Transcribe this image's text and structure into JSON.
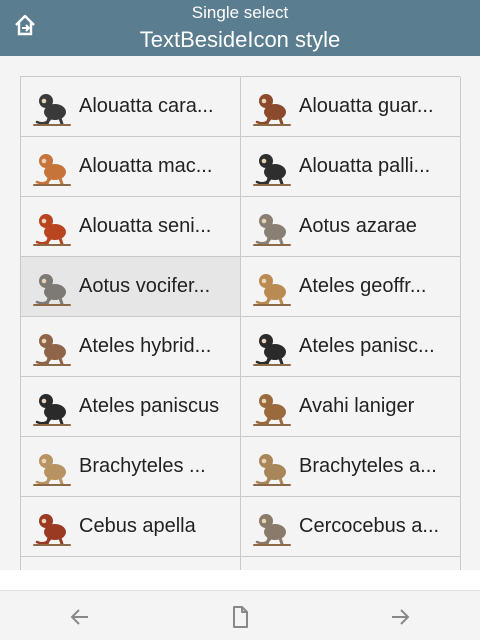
{
  "header": {
    "subtitle": "Single select",
    "title": "TextBesideIcon style"
  },
  "grid": {
    "selected_index": 6,
    "items": [
      {
        "label": "Alouatta cara...",
        "icon": "howler-monkey-black-icon",
        "color": "#3a3a3a"
      },
      {
        "label": "Alouatta guar...",
        "icon": "howler-monkey-brown-icon",
        "color": "#8b4a2b"
      },
      {
        "label": "Alouatta mac...",
        "icon": "howler-monkey-orange-icon",
        "color": "#c7743b"
      },
      {
        "label": "Alouatta palli...",
        "icon": "howler-monkey-dark-icon",
        "color": "#2e2e2e"
      },
      {
        "label": "Alouatta seni...",
        "icon": "howler-monkey-red-icon",
        "color": "#b8451f"
      },
      {
        "label": "Aotus azarae",
        "icon": "night-monkey-icon",
        "color": "#8a7f73"
      },
      {
        "label": "Aotus vocifer...",
        "icon": "night-monkey-gray-icon",
        "color": "#7d7a75"
      },
      {
        "label": "Ateles geoffr...",
        "icon": "spider-monkey-tan-icon",
        "color": "#b98a52"
      },
      {
        "label": "Ateles hybrid...",
        "icon": "spider-monkey-hanging-icon",
        "color": "#8e6548"
      },
      {
        "label": "Ateles panisc...",
        "icon": "spider-monkey-black-icon",
        "color": "#2a2a2a"
      },
      {
        "label": "Ateles paniscus",
        "icon": "spider-monkey-black-hanging-icon",
        "color": "#2a2a2a"
      },
      {
        "label": "Avahi laniger",
        "icon": "woolly-lemur-icon",
        "color": "#9a6a3e"
      },
      {
        "label": "Brachyteles ...",
        "icon": "muriqui-icon",
        "color": "#b89362"
      },
      {
        "label": "Brachyteles a...",
        "icon": "muriqui-hanging-icon",
        "color": "#a8865a"
      },
      {
        "label": "Cebus apella",
        "icon": "capuchin-icon",
        "color": "#9b3a22"
      },
      {
        "label": "Cercocebus a...",
        "icon": "mangabey-icon",
        "color": "#8a7a6a"
      },
      {
        "label": "",
        "icon": "monkey-icon",
        "color": "#888888"
      },
      {
        "label": "",
        "icon": "monkey-icon",
        "color": "#888888"
      }
    ]
  },
  "bottom_bar": {
    "back_icon": "arrow-left-icon",
    "page_icon": "page-icon",
    "forward_icon": "arrow-right-icon"
  }
}
